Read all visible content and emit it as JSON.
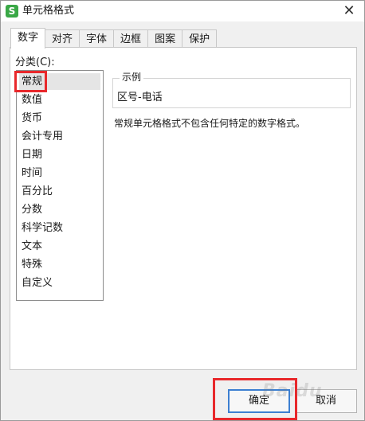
{
  "window": {
    "app_icon": "S",
    "title": "单元格格式",
    "close": "✕"
  },
  "tabs": [
    {
      "label": "数字",
      "active": true
    },
    {
      "label": "对齐",
      "active": false
    },
    {
      "label": "字体",
      "active": false
    },
    {
      "label": "边框",
      "active": false
    },
    {
      "label": "图案",
      "active": false
    },
    {
      "label": "保护",
      "active": false
    }
  ],
  "category": {
    "label": "分类(C):",
    "items": [
      "常规",
      "数值",
      "货币",
      "会计专用",
      "日期",
      "时间",
      "百分比",
      "分数",
      "科学记数",
      "文本",
      "特殊",
      "自定义"
    ],
    "selected": "常规"
  },
  "sample": {
    "legend": "示例",
    "value": "区号-电话"
  },
  "description": "常规单元格格式不包含任何特定的数字格式。",
  "buttons": {
    "ok": "确定",
    "cancel": "取消"
  },
  "watermark": "Baidu",
  "colors": {
    "highlight": "#e8282b",
    "focus_border": "#3c7fd1",
    "app_icon": "#3aa846"
  }
}
